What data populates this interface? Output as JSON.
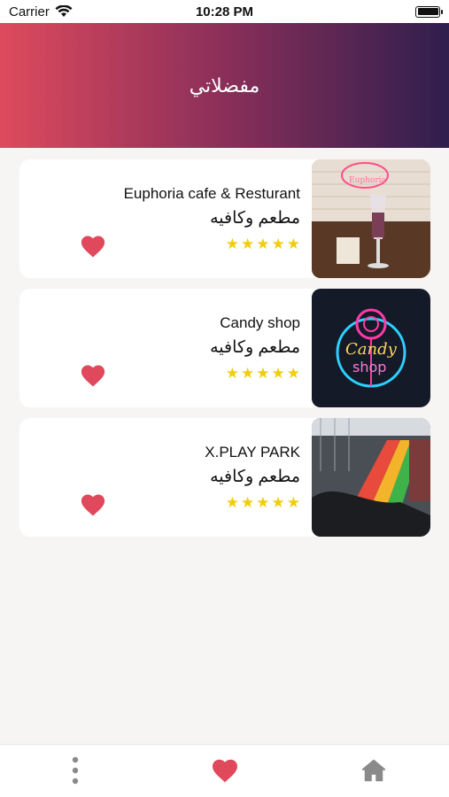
{
  "status_bar": {
    "carrier": "Carrier",
    "time": "10:28 PM"
  },
  "header": {
    "title": "مفضلاتي"
  },
  "favorites": [
    {
      "name": "Euphoria cafe & Resturant",
      "category": "مطعم وكافيه",
      "rating": 5
    },
    {
      "name": "Candy shop",
      "category": "مطعم وكافيه",
      "rating": 5
    },
    {
      "name": "X.PLAY PARK",
      "category": "مطعم وكافيه",
      "rating": 5
    }
  ],
  "colors": {
    "accent": "#e0485c",
    "star": "#f2cc0c",
    "header_start": "#de4a5d",
    "header_end": "#2f1e4e"
  },
  "tab_bar": {
    "items": [
      {
        "icon": "more-vertical-icon"
      },
      {
        "icon": "heart-icon",
        "active": true
      },
      {
        "icon": "home-icon"
      }
    ]
  }
}
